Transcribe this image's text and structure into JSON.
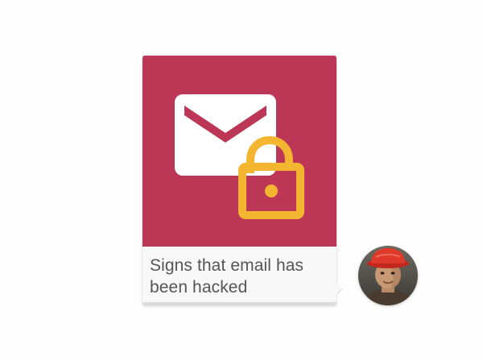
{
  "post": {
    "caption": "Signs that email has been hacked",
    "image_icon": "envelope-unlocked-padlock-icon",
    "image_background": "#bc3656",
    "lock_color": "#f4b630"
  },
  "author": {
    "avatar_icon": "avatar-person-red-cap"
  }
}
